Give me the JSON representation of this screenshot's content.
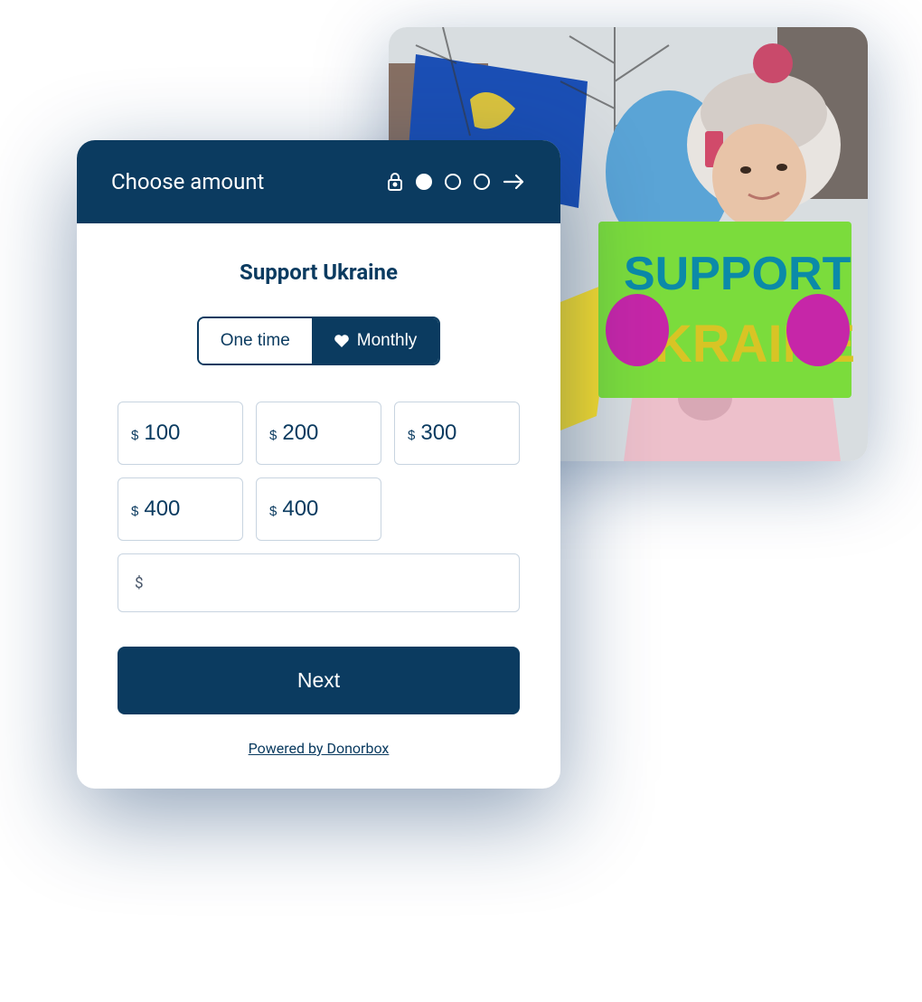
{
  "photo": {
    "sign_line1": "SUPPORT",
    "sign_line2": "UKRAINE"
  },
  "card": {
    "header": {
      "title": "Choose amount",
      "steps_total": 3,
      "step_active": 1
    },
    "title": "Support Ukraine",
    "frequency": {
      "one_time_label": "One time",
      "monthly_label": "Monthly",
      "selected": "monthly"
    },
    "currency_symbol": "$",
    "amounts": [
      "100",
      "200",
      "300",
      "400",
      "400"
    ],
    "custom_amount_value": "",
    "next_button_label": "Next",
    "powered_by_label": "Powered by Donorbox"
  }
}
